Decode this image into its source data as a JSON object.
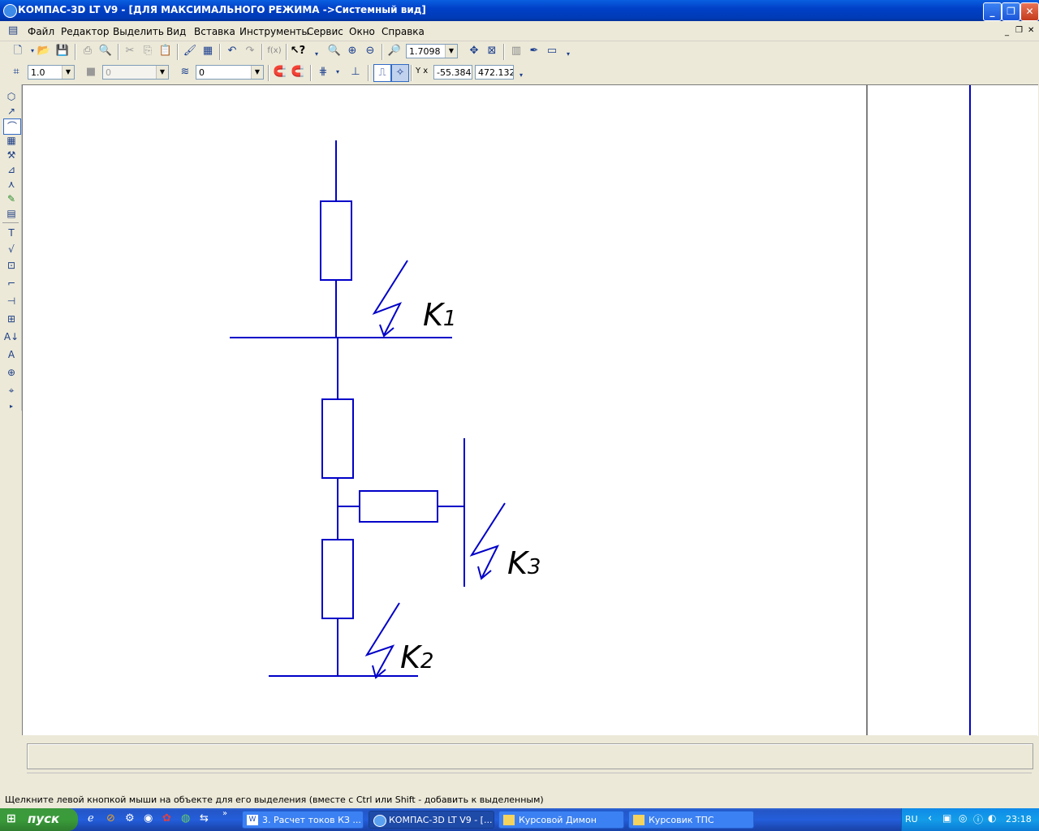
{
  "window": {
    "title": "КОМПАС-3D LT V9 - [ДЛЯ МАКСИМАЛЬНОГО РЕЖИМА ->Системный вид]"
  },
  "menu": {
    "items": [
      "Файл",
      "Редактор",
      "Выделить",
      "Вид",
      "Вставка",
      "Инструменты",
      "Сервис",
      "Окно",
      "Справка"
    ]
  },
  "toolbar": {
    "zoom_value": "1.7098",
    "fx_label": "f(x)"
  },
  "toolbar2": {
    "step_value": "1.0",
    "layer_value": "0",
    "style_value": "0",
    "coord_label": "Y x",
    "coord_x": "-55.384",
    "coord_y": "472.132"
  },
  "drawing": {
    "labels": [
      {
        "main": "K",
        "sub": "1"
      },
      {
        "main": "K",
        "sub": "3"
      },
      {
        "main": "K",
        "sub": "2"
      }
    ],
    "line_color": "#0000c8"
  },
  "statusbar": {
    "hint": "Щелкните левой кнопкой мыши на объекте для его выделения (вместе с Ctrl или Shift - добавить к выделенным)"
  },
  "taskbar": {
    "start_label": "пуск",
    "buttons": [
      {
        "label": "3. Расчет токов КЗ ...",
        "active": false
      },
      {
        "label": "КОМПАС-3D LT V9 - [...",
        "active": true
      },
      {
        "label": "Курсовой Димон",
        "active": false
      },
      {
        "label": "Курсовик ТПС",
        "active": false
      }
    ],
    "lang": "RU",
    "clock": "23:18"
  }
}
